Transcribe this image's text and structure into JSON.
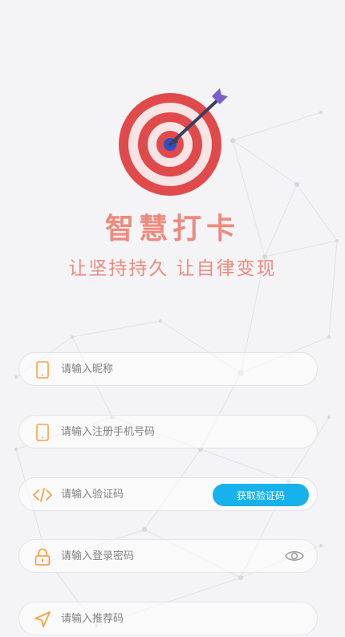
{
  "app": {
    "title": "智慧打卡",
    "slogan": "让坚持持久 让自律变现"
  },
  "form": {
    "nickname": {
      "placeholder": "请输入昵称",
      "value": ""
    },
    "phone": {
      "placeholder": "请输入注册手机号码",
      "value": ""
    },
    "code": {
      "placeholder": "请输入验证码",
      "value": "",
      "button_label": "获取验证码"
    },
    "password": {
      "placeholder": "请输入登录密码",
      "value": ""
    },
    "referral": {
      "placeholder": "请输入推荐码",
      "value": ""
    }
  },
  "colors": {
    "brand": "#ec8a7e",
    "accent_button": "#17b2ec",
    "icon_orange": "#f5a24a",
    "target_red": "#e04a4a"
  },
  "icons": {
    "logo": "target-arrow-icon",
    "nickname": "phone-icon",
    "phone": "phone-icon",
    "code": "code-icon",
    "password": "lock-icon",
    "password_toggle": "eye-icon",
    "referral": "navigation-icon"
  }
}
